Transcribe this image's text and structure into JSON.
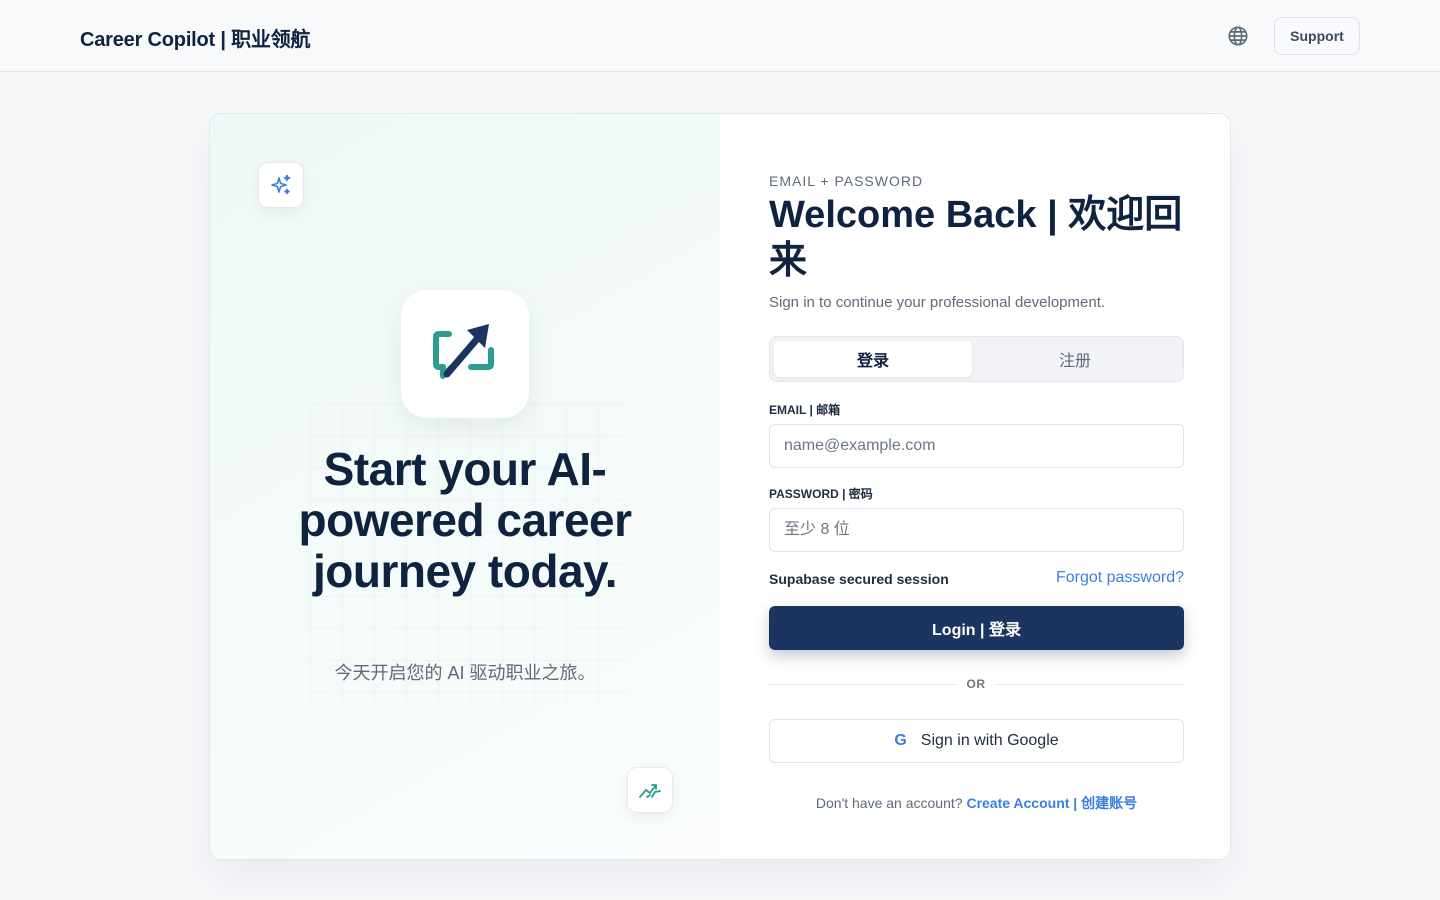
{
  "header": {
    "brand": "Career Copilot | 职业领航",
    "support_label": "Support"
  },
  "hero": {
    "title": "Start your AI-powered career journey today.",
    "subtitle": "今天开启您的 AI 驱动职业之旅。"
  },
  "form": {
    "eyebrow": "EMAIL + PASSWORD",
    "title": "Welcome Back | 欢迎回来",
    "subtitle": "Sign in to continue your professional development.",
    "tabs": [
      {
        "label": "登录",
        "active": true
      },
      {
        "label": "注册",
        "active": false
      }
    ],
    "email": {
      "label": "EMAIL | 邮箱",
      "placeholder": "name@example.com",
      "value": ""
    },
    "password": {
      "label": "PASSWORD | 密码",
      "placeholder": "至少 8 位",
      "value": ""
    },
    "session_note": "Supabase secured session",
    "forgot_label": "Forgot password?",
    "login_label": "Login | 登录",
    "divider_label": "OR",
    "google_label": "Sign in with Google",
    "google_icon_letter": "G",
    "signup_prompt": "Don't have an account?",
    "signup_link": "Create Account | 创建账号"
  },
  "icons": {
    "globe": "globe-icon",
    "sparkle": "sparkles-icon",
    "logo": "arrow-chat-logo",
    "chart": "trend-chart-icon"
  },
  "colors": {
    "primary": "#1b3560",
    "accent_blue": "#3b7ee0",
    "logo_teal": "#2a9d8f",
    "logo_navy": "#1b3560",
    "text_dark": "#0f2340",
    "text_muted": "#5f6b7a"
  }
}
